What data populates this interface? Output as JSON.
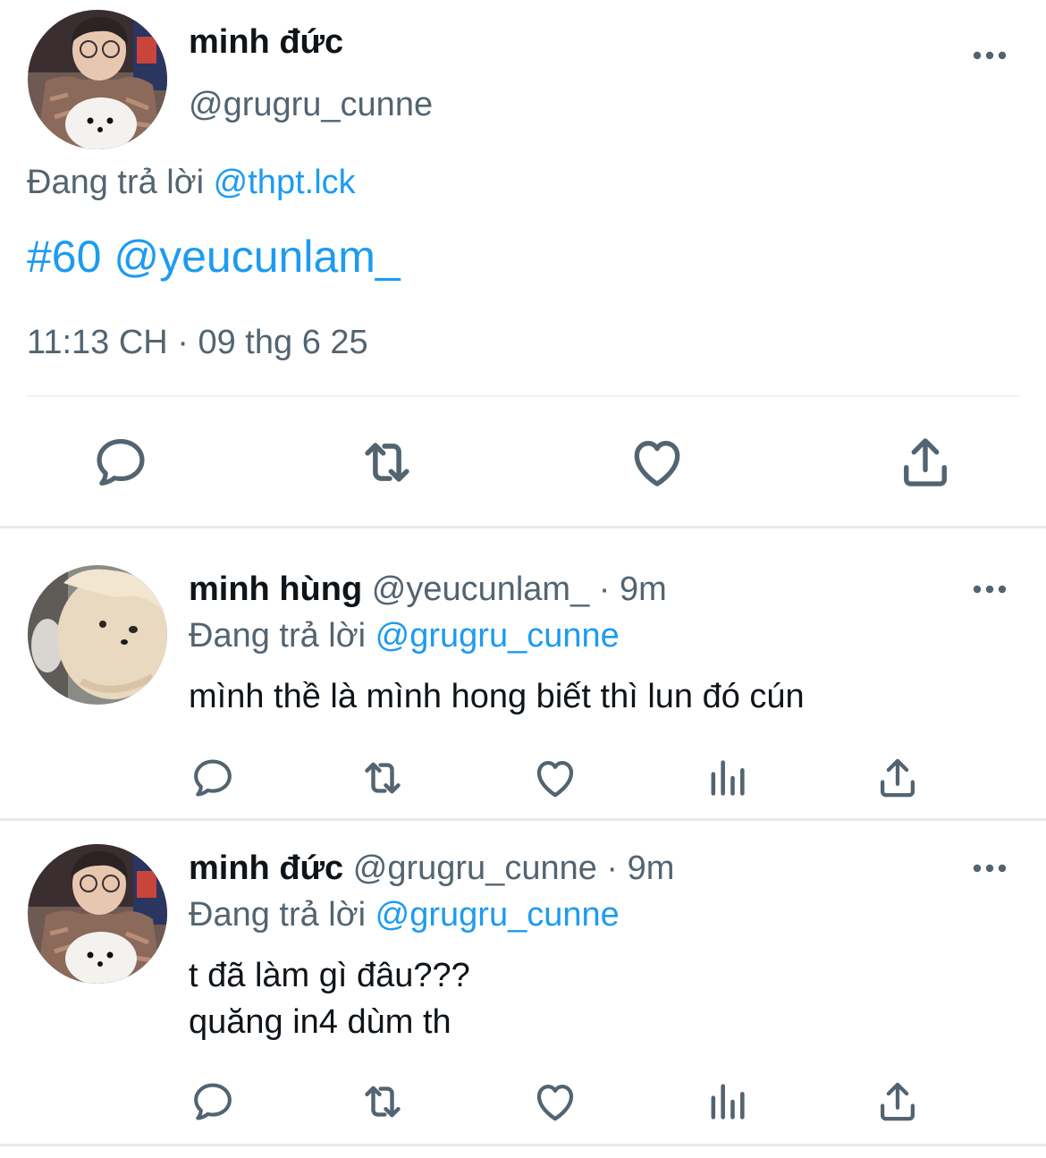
{
  "main_tweet": {
    "display_name": "minh đức",
    "handle": "@grugru_cunne",
    "replying_label": "Đang trả lời",
    "replying_to": "@thpt.lck",
    "text_tag": "#60",
    "text_mention": "@yeucunlam_",
    "timestamp": "11:13 CH · 09 thg 6 25"
  },
  "replies": [
    {
      "display_name": "minh hùng",
      "handle": "@yeucunlam_",
      "time": "· 9m",
      "replying_label": "Đang trả lời",
      "replying_to": "@grugru_cunne",
      "text": "mình thề là mình hong biết thì lun đó cún"
    },
    {
      "display_name": "minh đức",
      "handle": "@grugru_cunne",
      "time": "· 9m",
      "replying_label": "Đang trả lời",
      "replying_to": "@grugru_cunne",
      "text": "t đã làm gì đâu???\nquăng in4 dùm th"
    }
  ],
  "icons": {
    "reply": "reply-icon",
    "retweet": "retweet-icon",
    "like": "heart-icon",
    "share": "share-icon",
    "analytics": "analytics-icon",
    "more": "more-options-icon"
  },
  "colors": {
    "link": "#1d9bf0",
    "muted": "#536471",
    "text": "#0f1419"
  }
}
